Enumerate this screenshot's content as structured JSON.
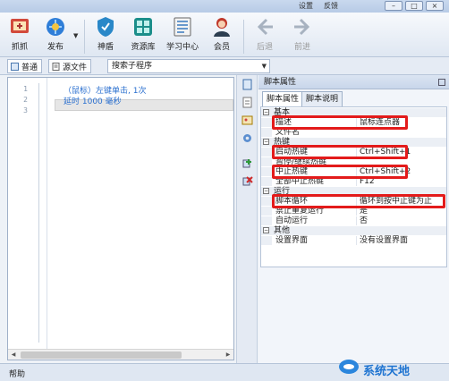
{
  "top": {
    "link1": "设置",
    "link2": "反馈"
  },
  "toolbar": {
    "capture": "抓抓",
    "publish": "发布",
    "shield": "神盾",
    "resources": "资源库",
    "learning": "学习中心",
    "member": "会员",
    "back": "后退",
    "forward": "前进"
  },
  "tabs": {
    "normal": "普通",
    "source": "源文件",
    "search_sub": "搜索子程序"
  },
  "editor": {
    "line_numbers": [
      "1",
      "2",
      "3"
    ],
    "lines": [
      "（鼠标）左键单击, 1次",
      "延时 1000 毫秒"
    ]
  },
  "properties": {
    "title": "脚本属性",
    "tabs": [
      "脚本属性",
      "脚本说明"
    ],
    "categories": {
      "basic": "基本",
      "hotkey": "热键",
      "run": "运行",
      "other": "其他"
    },
    "rows": {
      "desc": {
        "name": "描述",
        "value": "鼠标连点器"
      },
      "filename": {
        "name": "文件名",
        "value": ""
      },
      "start_hotkey": {
        "name": "启动热键",
        "value": "Ctrl+Shift+1"
      },
      "pause_hotkey": {
        "name": "暂停/继续热键",
        "value": ""
      },
      "stop_hotkey": {
        "name": "中止热键",
        "value": "Ctrl+Shift+2"
      },
      "stop_all": {
        "name": "全部中止热键",
        "value": "F12"
      },
      "loop": {
        "name": "脚本循环",
        "value": "循环到按中止键为止"
      },
      "no_repeat": {
        "name": "禁止重复运行",
        "value": "是"
      },
      "auto_run": {
        "name": "自动运行",
        "value": "否"
      },
      "settings_ui": {
        "name": "设置界面",
        "value": "没有设置界面"
      }
    }
  },
  "status": {
    "text": "帮助"
  },
  "watermark": {
    "text": "系统天地"
  },
  "colors": {
    "highlight": "#e31b1b",
    "code_text": "#2a6fcf"
  }
}
